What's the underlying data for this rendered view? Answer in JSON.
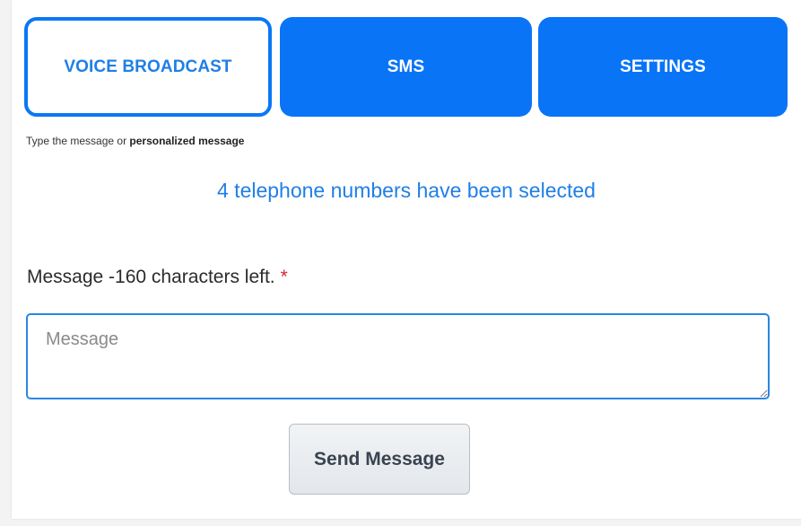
{
  "tabs": {
    "voice_broadcast": "VOICE BROADCAST",
    "sms": "SMS",
    "settings": "SETTINGS"
  },
  "hint": {
    "prefix": "Type the message or ",
    "bold": "personalized message"
  },
  "selection_info": "4 telephone numbers have been selected",
  "message": {
    "label": "Message -160 characters left.",
    "required_marker": "*",
    "placeholder": "Message",
    "value": ""
  },
  "send_button_label": "Send Message",
  "colors": {
    "accent": "#0a74f7",
    "info_text": "#1f7fe6",
    "required": "#d9262c"
  }
}
